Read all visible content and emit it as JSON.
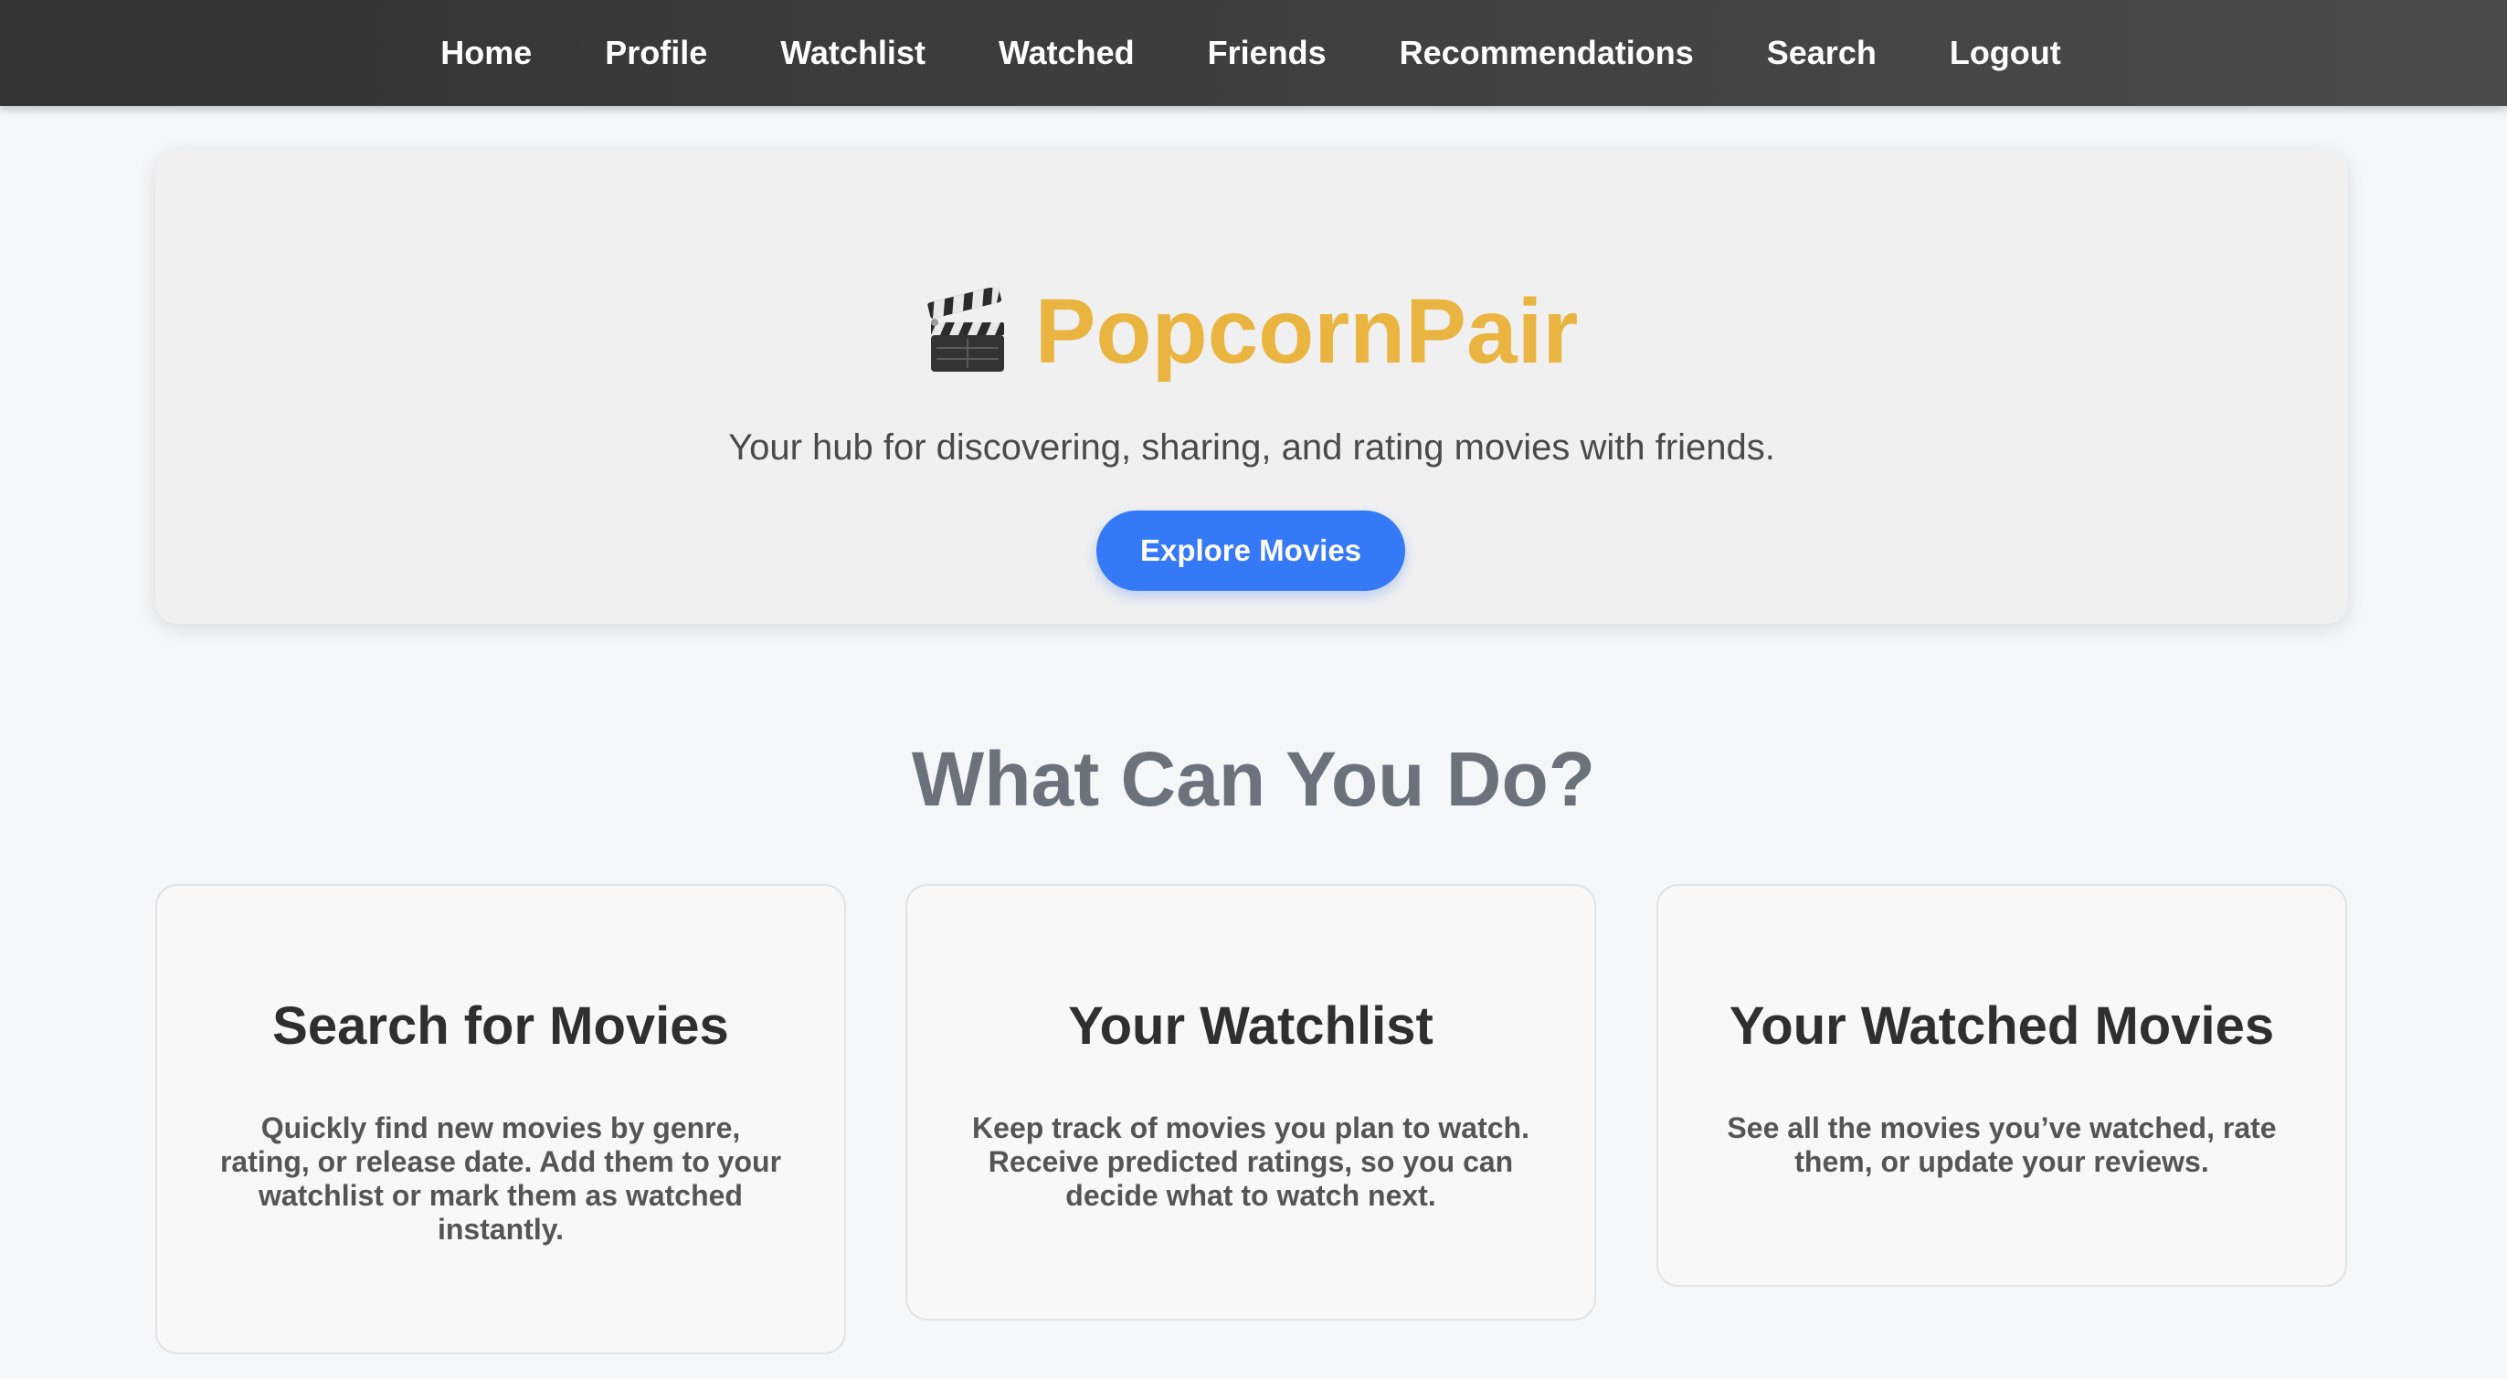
{
  "nav": {
    "items": [
      {
        "label": "Home"
      },
      {
        "label": "Profile"
      },
      {
        "label": "Watchlist"
      },
      {
        "label": "Watched"
      },
      {
        "label": "Friends"
      },
      {
        "label": "Recommendations"
      },
      {
        "label": "Search"
      },
      {
        "label": "Logout"
      }
    ]
  },
  "hero": {
    "icon": "clapperboard-icon",
    "title": "PopcornPair",
    "subtitle": "Your hub for discovering, sharing, and rating movies with friends.",
    "button_label": "Explore Movies"
  },
  "features": {
    "heading": "What Can You Do?",
    "cards": [
      {
        "title": "Search for Movies",
        "description": "Quickly find new movies by genre, rating, or release date. Add them to your watchlist or mark them as watched instantly."
      },
      {
        "title": "Your Watchlist",
        "description": "Keep track of movies you plan to watch. Receive predicted ratings, so you can decide what to watch next."
      },
      {
        "title": "Your Watched Movies",
        "description": "See all the movies you’ve watched, rate them, or update your reviews."
      }
    ]
  },
  "colors": {
    "brand_title": "#e9b440",
    "accent_button": "#3579f6",
    "navbar_background": "#3f3f3f",
    "page_background": "#f5f6f8"
  }
}
